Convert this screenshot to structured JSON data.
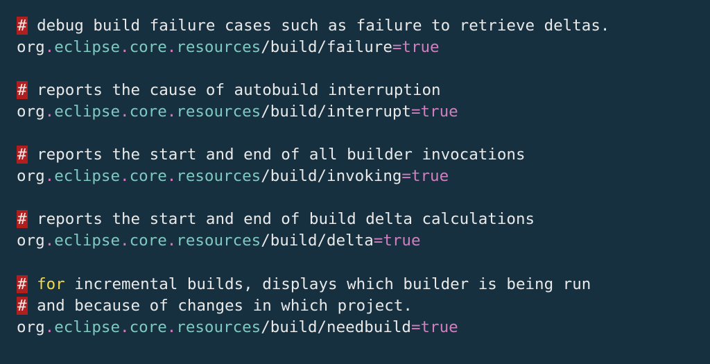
{
  "lines": [
    {
      "type": "comment",
      "hash": "#",
      "text": " debug build failure cases such as failure to retrieve deltas."
    },
    {
      "type": "prop",
      "pkg": "org",
      "segs": [
        "eclipse",
        "core",
        "resources"
      ],
      "path": [
        "build",
        "failure"
      ],
      "eq": "=",
      "val": "true"
    },
    {
      "type": "blank"
    },
    {
      "type": "comment",
      "hash": "#",
      "text": " reports the cause of autobuild interruption"
    },
    {
      "type": "prop",
      "pkg": "org",
      "segs": [
        "eclipse",
        "core",
        "resources"
      ],
      "path": [
        "build",
        "interrupt"
      ],
      "eq": "=",
      "val": "true"
    },
    {
      "type": "blank"
    },
    {
      "type": "comment",
      "hash": "#",
      "text": " reports the start and end of all builder invocations"
    },
    {
      "type": "prop",
      "pkg": "org",
      "segs": [
        "eclipse",
        "core",
        "resources"
      ],
      "path": [
        "build",
        "invoking"
      ],
      "eq": "=",
      "val": "true"
    },
    {
      "type": "blank"
    },
    {
      "type": "comment",
      "hash": "#",
      "text": " reports the start and end of build delta calculations"
    },
    {
      "type": "prop",
      "pkg": "org",
      "segs": [
        "eclipse",
        "core",
        "resources"
      ],
      "path": [
        "build",
        "delta"
      ],
      "eq": "=",
      "val": "true"
    },
    {
      "type": "blank"
    },
    {
      "type": "comment",
      "hash": "#",
      "pre": " ",
      "kw_for": "for",
      "text": " incremental builds, displays which builder is being run"
    },
    {
      "type": "comment",
      "hash": "#",
      "text": " and because of changes in which project."
    },
    {
      "type": "prop",
      "pkg": "org",
      "segs": [
        "eclipse",
        "core",
        "resources"
      ],
      "path": [
        "build",
        "needbuild"
      ],
      "eq": "=",
      "val": "true"
    }
  ],
  "tokens": {
    "dot": ".",
    "slash": "/"
  }
}
